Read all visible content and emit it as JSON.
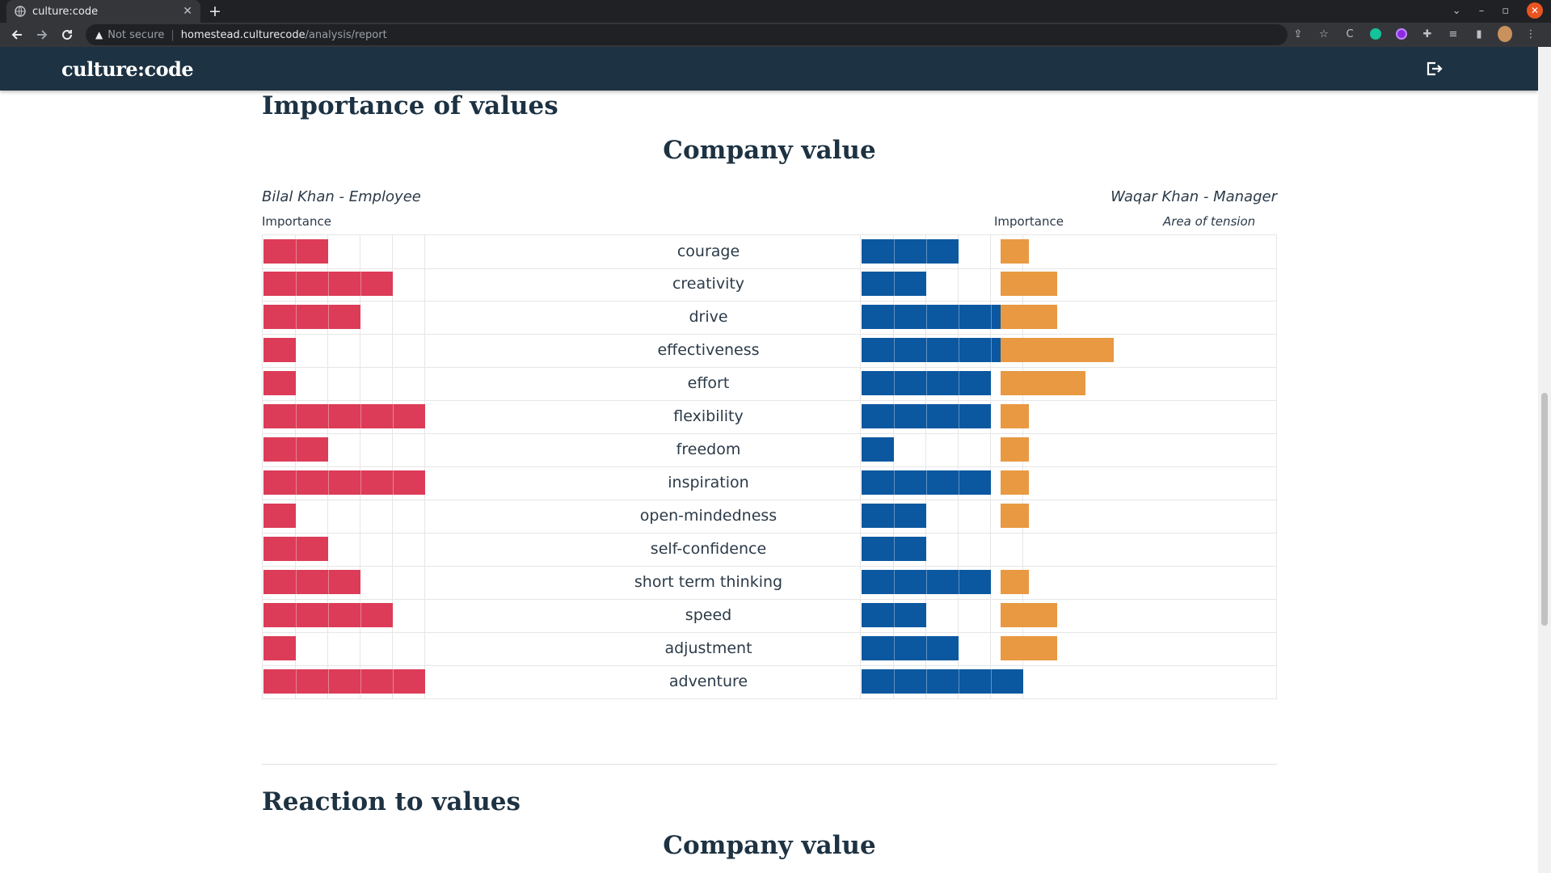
{
  "browser": {
    "tab_title": "culture:code",
    "security_label": "Not secure",
    "url_host": "homestead.culturecode",
    "url_path": "/analysis/report"
  },
  "app": {
    "brand": "culture:code"
  },
  "section1": {
    "title": "Importance of values",
    "subtitle": "Company value",
    "employee_label": "Bilal Khan - Employee",
    "manager_label": "Waqar Khan - Manager",
    "employee_col": "Importance",
    "manager_col": "Importance",
    "tension_col": "Area of tension",
    "max_level": 5,
    "rows": [
      {
        "value": "courage",
        "employee": 2,
        "manager": 3,
        "tension": 1
      },
      {
        "value": "creativity",
        "employee": 4,
        "manager": 2,
        "tension": 2
      },
      {
        "value": "drive",
        "employee": 3,
        "manager": 5,
        "tension": 2
      },
      {
        "value": "effectiveness",
        "employee": 1,
        "manager": 5,
        "tension": 4
      },
      {
        "value": "effort",
        "employee": 1,
        "manager": 4,
        "tension": 3
      },
      {
        "value": "flexibility",
        "employee": 5,
        "manager": 4,
        "tension": 1
      },
      {
        "value": "freedom",
        "employee": 2,
        "manager": 1,
        "tension": 1
      },
      {
        "value": "inspiration",
        "employee": 5,
        "manager": 4,
        "tension": 1
      },
      {
        "value": "open-mindedness",
        "employee": 1,
        "manager": 2,
        "tension": 1
      },
      {
        "value": "self-confidence",
        "employee": 2,
        "manager": 2,
        "tension": 0
      },
      {
        "value": "short term thinking",
        "employee": 3,
        "manager": 4,
        "tension": 1
      },
      {
        "value": "speed",
        "employee": 4,
        "manager": 2,
        "tension": 2
      },
      {
        "value": "adjustment",
        "employee": 1,
        "manager": 3,
        "tension": 2
      },
      {
        "value": "adventure",
        "employee": 5,
        "manager": 5,
        "tension": 0
      }
    ]
  },
  "section2": {
    "title": "Reaction to values",
    "subtitle": "Company value"
  },
  "colors": {
    "employee": "#dc3c58",
    "manager": "#0b58a0",
    "tension": "#e89942",
    "appbar": "#1d3242"
  }
}
